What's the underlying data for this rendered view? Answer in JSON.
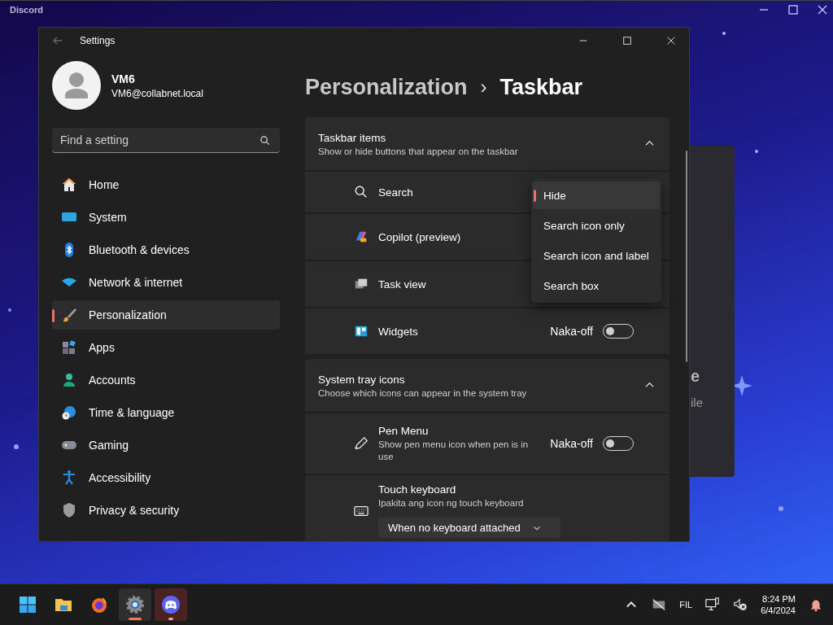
{
  "app_window": {
    "title": "Discord",
    "behind_card": {
      "text_1": "e",
      "text_2": "ile"
    }
  },
  "settings": {
    "title": "Settings",
    "user": {
      "name": "VM6",
      "email": "VM6@collabnet.local"
    },
    "search": {
      "placeholder": "Find a setting"
    },
    "nav": [
      {
        "kind": "home",
        "label": "Home",
        "selected": false
      },
      {
        "kind": "system",
        "label": "System",
        "selected": false
      },
      {
        "kind": "bluetooth",
        "label": "Bluetooth & devices",
        "selected": false
      },
      {
        "kind": "network",
        "label": "Network & internet",
        "selected": false
      },
      {
        "kind": "brush",
        "label": "Personalization",
        "selected": true
      },
      {
        "kind": "apps",
        "label": "Apps",
        "selected": false
      },
      {
        "kind": "accounts",
        "label": "Accounts",
        "selected": false
      },
      {
        "kind": "time",
        "label": "Time & language",
        "selected": false
      },
      {
        "kind": "gaming",
        "label": "Gaming",
        "selected": false
      },
      {
        "kind": "accessibility",
        "label": "Accessibility",
        "selected": false
      },
      {
        "kind": "privacy",
        "label": "Privacy & security",
        "selected": false
      }
    ],
    "breadcrumb": {
      "parent": "Personalization",
      "separator": "›",
      "current": "Taskbar"
    },
    "sections": [
      {
        "title": "Taskbar items",
        "subtitle": "Show or hide buttons that appear on the taskbar",
        "expanded": true,
        "rows": [
          {
            "kind": "search",
            "label": "Search"
          },
          {
            "kind": "copilot",
            "label": "Copilot (preview)"
          },
          {
            "kind": "taskview",
            "label": "Task view"
          },
          {
            "kind": "widgets",
            "label": "Widgets",
            "state_label": "Naka-off",
            "on": false
          }
        ]
      },
      {
        "title": "System tray icons",
        "subtitle": "Choose which icons can appear in the system tray",
        "expanded": true,
        "rows": [
          {
            "kind": "pen",
            "label": "Pen Menu",
            "description": "Show pen menu icon when pen is in use",
            "state_label": "Naka-off",
            "on": false
          },
          {
            "kind": "keyboard",
            "label": "Touch keyboard",
            "description": "Ipakita ang icon ng touch keyboard",
            "value": "When no keyboard attached"
          }
        ]
      }
    ],
    "dropdown_menu": {
      "options": [
        {
          "label": "Hide",
          "selected": true
        },
        {
          "label": "Search icon only",
          "selected": false
        },
        {
          "label": "Search icon and label",
          "selected": false
        },
        {
          "label": "Search box",
          "selected": false
        }
      ]
    }
  },
  "taskbar": {
    "apps": [
      {
        "kind": "start",
        "selected": false,
        "running": false,
        "attention": false
      },
      {
        "kind": "folder",
        "selected": false,
        "running": false,
        "attention": false
      },
      {
        "kind": "firefox",
        "selected": false,
        "running": false,
        "attention": false
      },
      {
        "kind": "settings",
        "selected": true,
        "running": true,
        "attention": false
      },
      {
        "kind": "discord",
        "selected": false,
        "running": true,
        "attention": true
      }
    ],
    "language": "FIL",
    "time": "8:24 PM",
    "date": "6/4/2024"
  }
}
